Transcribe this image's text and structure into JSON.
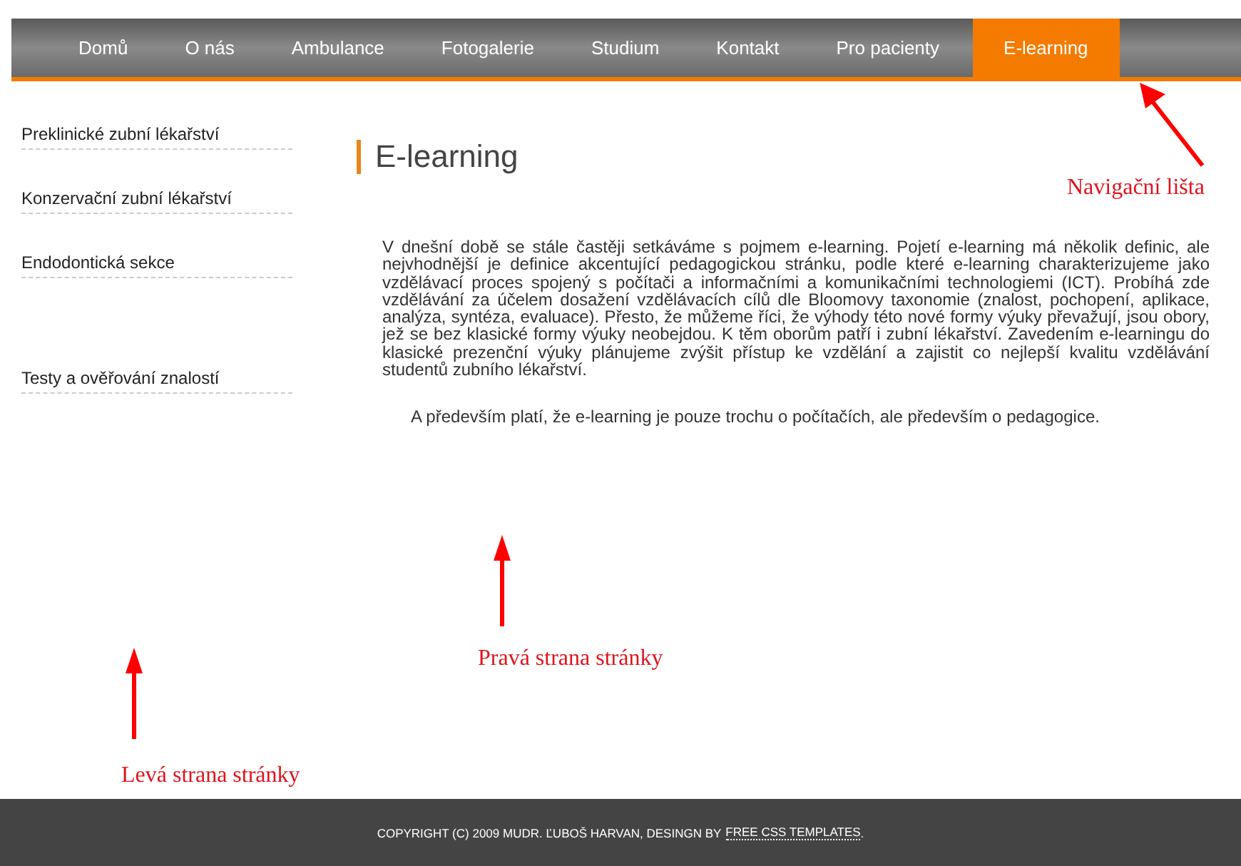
{
  "nav": [
    {
      "label": "Domů",
      "selected": false
    },
    {
      "label": "O nás",
      "selected": false
    },
    {
      "label": "Ambulance",
      "selected": false
    },
    {
      "label": "Fotogalerie",
      "selected": false
    },
    {
      "label": "Studium",
      "selected": false
    },
    {
      "label": "Kontakt",
      "selected": false
    },
    {
      "label": "Pro pacienty",
      "selected": false
    },
    {
      "label": "E-learning",
      "selected": true
    }
  ],
  "sidebar": {
    "groups": [
      [
        "Preklinické zubní lékařství",
        "Konzervační zubní lékařství",
        "Endodontická sekce"
      ],
      [
        "Testy a ověřování znalostí"
      ]
    ]
  },
  "content": {
    "title": "E-learning",
    "paragraphs": [
      "V dnešní době se stále častěji setkáváme s pojmem e-learning. Pojetí e-learning má několik definic, ale nejvhodnější je definice akcentující pedagogickou stránku, podle které e-learning charakterizujeme jako vzdělávací proces spojený s počítači a informačními a komunikačními technologiemi (ICT). Probíhá zde vzdělávání za účelem dosažení vzdělávacích cílů dle Bloomovy taxonomie (znalost, pochopení, aplikace, analýza, syntéza, evaluace). Přesto, že můžeme říci, že výhody této nové formy výuky převažují, jsou obory, jež se bez klasické formy výuky neobejdou. K těm oborům patří i zubní lékařství. Zavedením e-learningu do klasické prezenční výuky plánujeme zvýšit přístup ke vzdělání a zajistit  co nejlepší kvalitu vzdělávání studentů zubního lékařství."
    ],
    "note": "A především platí, že e-learning je pouze trochu o počítačích, ale především o pedagogice."
  },
  "footer": {
    "text": "COPYRIGHT (C) 2009 MUDR. ĽUBOŠ HARVAN, DESINGN BY",
    "link": "FREE CSS TEMPLATES",
    "end": "."
  },
  "annotations": [
    "Navigační lišta",
    "Pravá strana stránky",
    "Levá strana stránky"
  ]
}
